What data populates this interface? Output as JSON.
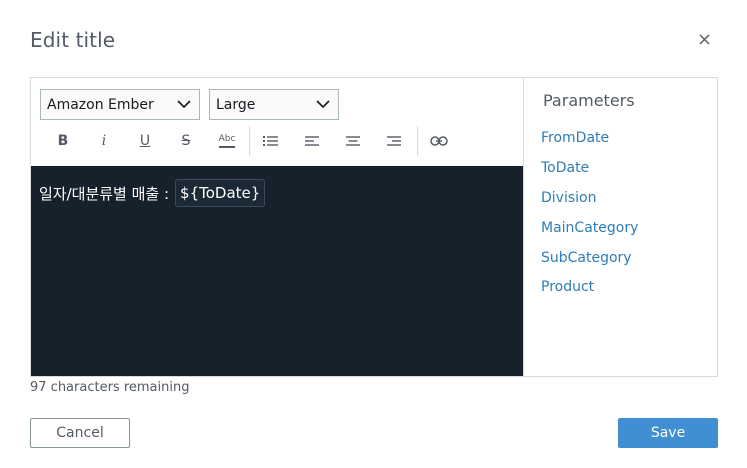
{
  "dialog": {
    "title": "Edit title",
    "close_icon": "close-icon"
  },
  "editor": {
    "font_select": {
      "value": "Amazon Ember"
    },
    "size_select": {
      "value": "Large"
    },
    "toolbar": {
      "bold": "B",
      "italic": "i",
      "underline": "U",
      "strikethrough": "S",
      "text_color": "Abc",
      "icons": [
        "bold-icon",
        "italic-icon",
        "underline-icon",
        "strikethrough-icon",
        "text-color-icon",
        "bulleted-list-icon",
        "align-left-icon",
        "align-center-icon",
        "align-right-icon",
        "link-icon"
      ]
    },
    "content": {
      "text": "일자/대분류별 매출 :",
      "parameter_token": "${ToDate}"
    },
    "background_color": "#16212c"
  },
  "parameters": {
    "heading": "Parameters",
    "items": [
      "FromDate",
      "ToDate",
      "Division",
      "MainCategory",
      "SubCategory",
      "Product"
    ],
    "link_color": "#2e7db8"
  },
  "footer": {
    "remaining": "97 characters remaining",
    "cancel_label": "Cancel",
    "save_label": "Save",
    "save_color": "#3f8fd2"
  }
}
